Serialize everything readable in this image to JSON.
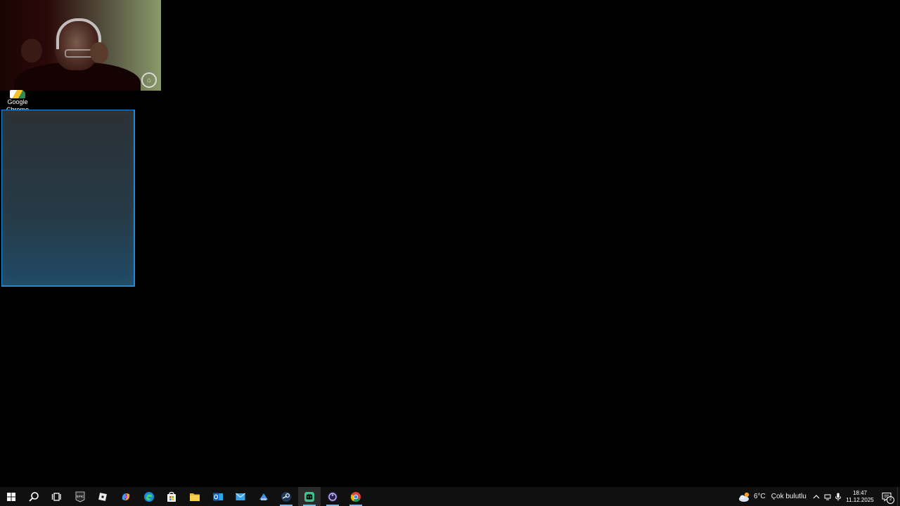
{
  "desktop": {
    "icon_label": "Google Chrome"
  },
  "taskbar": {
    "pinned": [
      {
        "name": "start",
        "active": false,
        "running": false
      },
      {
        "name": "search",
        "active": false,
        "running": false
      },
      {
        "name": "task-view",
        "active": false,
        "running": false
      },
      {
        "name": "epic-games",
        "active": false,
        "running": false
      },
      {
        "name": "roblox",
        "active": false,
        "running": false
      },
      {
        "name": "copilot",
        "active": false,
        "running": false
      },
      {
        "name": "edge",
        "active": false,
        "running": false
      },
      {
        "name": "microsoft-store",
        "active": false,
        "running": false
      },
      {
        "name": "file-explorer",
        "active": false,
        "running": false
      },
      {
        "name": "outlook",
        "active": false,
        "running": false
      },
      {
        "name": "mail",
        "active": false,
        "running": false
      },
      {
        "name": "app-blue",
        "active": false,
        "running": false
      },
      {
        "name": "steam",
        "active": false,
        "running": true
      },
      {
        "name": "discord-green",
        "active": true,
        "running": true
      },
      {
        "name": "obs",
        "active": false,
        "running": true
      },
      {
        "name": "chrome",
        "active": false,
        "running": true
      }
    ],
    "weather": {
      "temp": "6°C",
      "condition": "Çok bulutlu"
    },
    "time": "18:47",
    "date": "11.12.2025",
    "notification_count": "2"
  },
  "colors": {
    "accent": "#1e8bd8",
    "taskbar_bg": "#101010"
  }
}
